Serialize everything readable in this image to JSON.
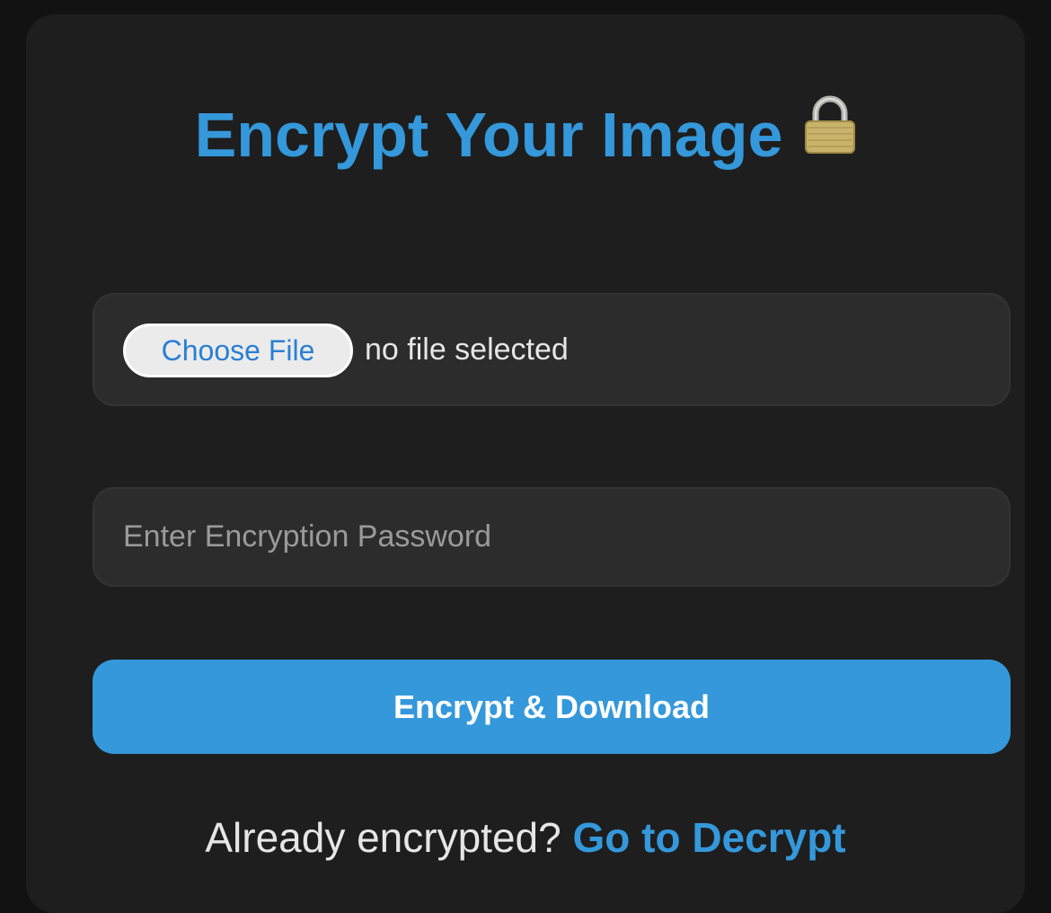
{
  "page": {
    "title": "Encrypt Your Image",
    "title_icon": "lock-icon"
  },
  "file_picker": {
    "button_label": "Choose File",
    "status": "no file selected"
  },
  "password": {
    "placeholder": "Enter Encryption Password",
    "value": ""
  },
  "encrypt_button": {
    "label": "Encrypt & Download"
  },
  "footer": {
    "text": "Already encrypted?",
    "link_label": "Go to Decrypt"
  },
  "colors": {
    "accent": "#3498db",
    "background": "#121212",
    "card": "#1e1e1e",
    "input": "#2c2c2c"
  }
}
